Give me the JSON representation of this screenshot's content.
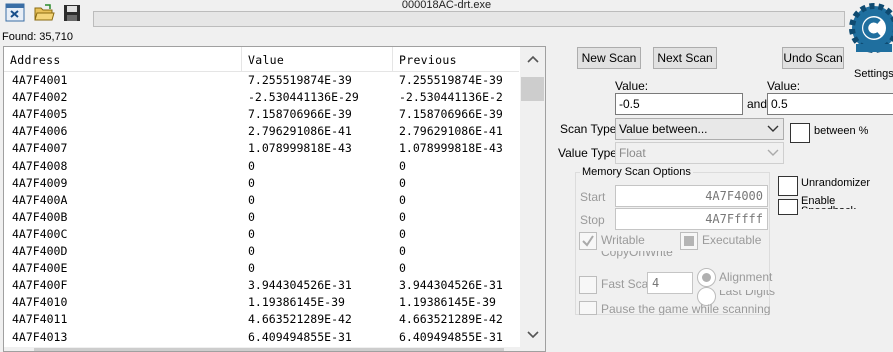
{
  "window": {
    "title": "000018AC-drt.exe"
  },
  "toolbar": {
    "icons": [
      "process-select-icon",
      "open-folder-icon",
      "save-icon"
    ]
  },
  "found_label": "Found: 35,710",
  "settings_label": "Settings",
  "results": {
    "headers": [
      "Address",
      "Value",
      "Previous"
    ],
    "rows": [
      {
        "address": "4A7F4001",
        "value": "7.255519874E-39",
        "previous": "7.255519874E-39"
      },
      {
        "address": "4A7F4002",
        "value": "-2.530441136E-29",
        "previous": "-2.530441136E-2"
      },
      {
        "address": "4A7F4005",
        "value": "7.158706966E-39",
        "previous": "7.158706966E-39"
      },
      {
        "address": "4A7F4006",
        "value": "2.796291086E-41",
        "previous": "2.796291086E-41"
      },
      {
        "address": "4A7F4007",
        "value": "1.078999818E-43",
        "previous": "1.078999818E-43"
      },
      {
        "address": "4A7F4008",
        "value": "0",
        "previous": "0"
      },
      {
        "address": "4A7F4009",
        "value": "0",
        "previous": "0"
      },
      {
        "address": "4A7F400A",
        "value": "0",
        "previous": "0"
      },
      {
        "address": "4A7F400B",
        "value": "0",
        "previous": "0"
      },
      {
        "address": "4A7F400C",
        "value": "0",
        "previous": "0"
      },
      {
        "address": "4A7F400D",
        "value": "0",
        "previous": "0"
      },
      {
        "address": "4A7F400E",
        "value": "0",
        "previous": "0"
      },
      {
        "address": "4A7F400F",
        "value": "3.944304526E-31",
        "previous": "3.944304526E-31"
      },
      {
        "address": "4A7F4010",
        "value": "1.19386145E-39",
        "previous": "1.19386145E-39"
      },
      {
        "address": "4A7F4011",
        "value": "4.663521289E-42",
        "previous": "4.663521289E-42"
      },
      {
        "address": "4A7F4013",
        "value": "6.409494855E-31",
        "previous": "6.409494855E-31"
      }
    ]
  },
  "buttons": {
    "new_scan": "New Scan",
    "next_scan": "Next Scan",
    "undo_scan": "Undo Scan"
  },
  "value1": {
    "label": "Value:",
    "value": "-0.5"
  },
  "and_label": "and",
  "value2": {
    "label": "Value:",
    "value": "0.5"
  },
  "between_pct_label": "between %",
  "scan_type": {
    "label": "Scan Type",
    "selected": "Value between..."
  },
  "value_type": {
    "label": "Value Type",
    "selected": "Float"
  },
  "memory_scan": {
    "title": "Memory Scan Options",
    "start_label": "Start",
    "start_value": "4A7F4000",
    "stop_label": "Stop",
    "stop_value": "4A7Fffff",
    "writable_label": "Writable",
    "executable_label": "Executable",
    "copyonwrite_label": "CopyOnWrite",
    "fast_scan_label": "Fast Scan",
    "fast_scan_value": "4",
    "alignment_label": "Alignment",
    "last_digits_label": "Last Digits",
    "pause_label": "Pause the game while scanning"
  },
  "unrandomizer_label": "Unrandomizer",
  "speedhack_label": "Enable Speedhack",
  "colors": {
    "accent": "#1f6f9f",
    "scrollbar": "#cdcdcd"
  }
}
